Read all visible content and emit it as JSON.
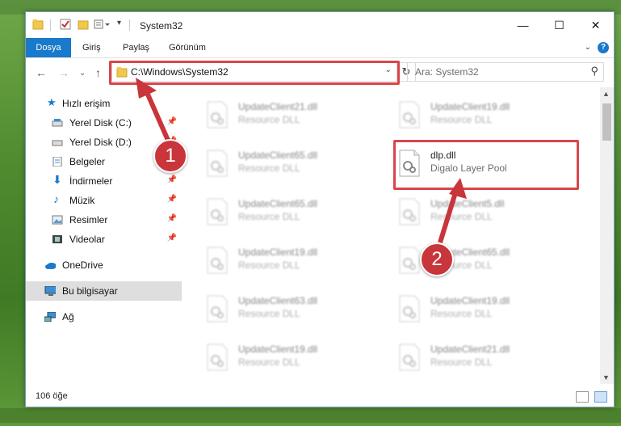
{
  "window": {
    "title": "System32"
  },
  "ribbon": {
    "tabs": [
      "Dosya",
      "Giriş",
      "Paylaş",
      "Görünüm"
    ],
    "help": "?"
  },
  "navigation": {
    "address": "C:\\Windows\\System32",
    "search_placeholder": "Ara: System32"
  },
  "sidebar": {
    "items": [
      {
        "label": "Hızlı erişim",
        "icon": "star-icon"
      },
      {
        "label": "Yerel Disk (C:)",
        "icon": "drive-icon",
        "pinned": true
      },
      {
        "label": "Yerel Disk (D:)",
        "icon": "drive-icon",
        "pinned": true
      },
      {
        "label": "Belgeler",
        "icon": "documents-icon",
        "pinned": true
      },
      {
        "label": "İndirmeler",
        "icon": "download-icon",
        "pinned": true
      },
      {
        "label": "Müzik",
        "icon": "music-icon",
        "pinned": true
      },
      {
        "label": "Resimler",
        "icon": "pictures-icon",
        "pinned": true
      },
      {
        "label": "Videolar",
        "icon": "video-icon",
        "pinned": true
      },
      {
        "label": "OneDrive",
        "icon": "cloud-icon"
      },
      {
        "label": "Bu bilgisayar",
        "icon": "computer-icon",
        "selected": true
      },
      {
        "label": "Ağ",
        "icon": "network-icon"
      }
    ]
  },
  "files": {
    "left_column": [
      {
        "name": "UpdateClient21.dll",
        "desc": "Resource DLL"
      },
      {
        "name": "UpdateClient65.dll",
        "desc": "Resource DLL"
      },
      {
        "name": "UpdateClient65.dll",
        "desc": "Resource DLL"
      },
      {
        "name": "UpdateClient19.dll",
        "desc": "Resource DLL"
      },
      {
        "name": "UpdateClient63.dll",
        "desc": "Resource DLL"
      },
      {
        "name": "UpdateClient19.dll",
        "desc": "Resource DLL"
      }
    ],
    "right_column": [
      {
        "name": "UpdateClient19.dll",
        "desc": "Resource DLL"
      },
      {
        "name": "dlp.dll",
        "desc": "Digalo Layer Pool"
      },
      {
        "name": "UpdateClient5.dll",
        "desc": "Resource DLL"
      },
      {
        "name": "UpdateClient65.dll",
        "desc": "Resource DLL"
      },
      {
        "name": "UpdateClient19.dll",
        "desc": "Resource DLL"
      },
      {
        "name": "UpdateClient21.dll",
        "desc": "Resource DLL"
      }
    ]
  },
  "status": {
    "count": "106 öğe"
  },
  "callouts": [
    "1",
    "2"
  ],
  "colors": {
    "accent": "#1979ca",
    "highlight": "#d9454a",
    "callout": "#c8353a"
  }
}
